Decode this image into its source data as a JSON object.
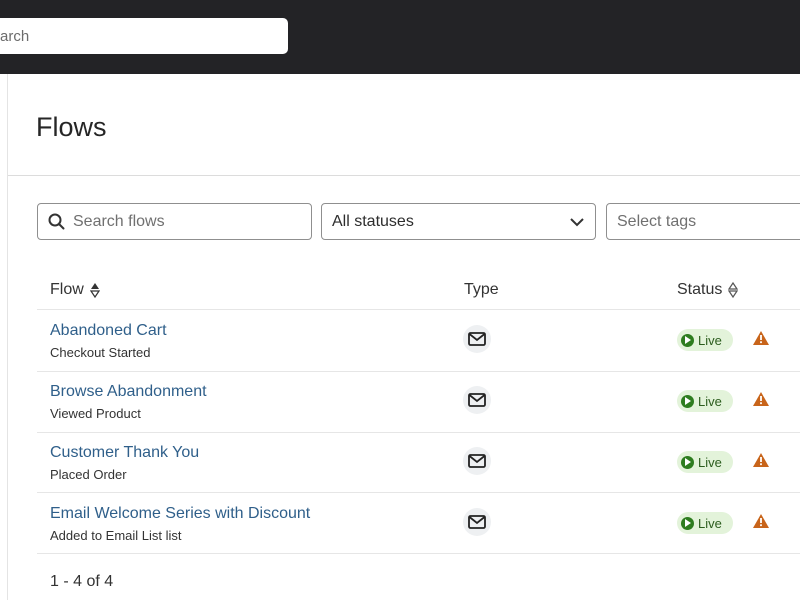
{
  "topbar": {
    "search_placeholder": "arch"
  },
  "page": {
    "title": "Flows"
  },
  "filters": {
    "search_placeholder": "Search flows",
    "status_value": "All statuses",
    "tags_placeholder": "Select tags"
  },
  "table": {
    "columns": {
      "flow": "Flow",
      "type": "Type",
      "status": "Status"
    },
    "rows": [
      {
        "name": "Abandoned Cart",
        "trigger": "Checkout Started",
        "type_icon": "email-icon",
        "status": "Live"
      },
      {
        "name": "Browse Abandonment",
        "trigger": "Viewed Product",
        "type_icon": "email-icon",
        "status": "Live"
      },
      {
        "name": "Customer Thank You",
        "trigger": "Placed Order",
        "type_icon": "email-icon",
        "status": "Live"
      },
      {
        "name": "Email Welcome Series with Discount",
        "trigger": "Added to Email List list",
        "type_icon": "email-icon",
        "status": "Live"
      }
    ]
  },
  "pagination": {
    "text": "1 - 4 of 4"
  },
  "colors": {
    "topbar": "#232326",
    "link": "#2f5f8a",
    "live_bg": "#e3f3da",
    "live_dot": "#2e7d1f",
    "warning": "#c8641a"
  }
}
